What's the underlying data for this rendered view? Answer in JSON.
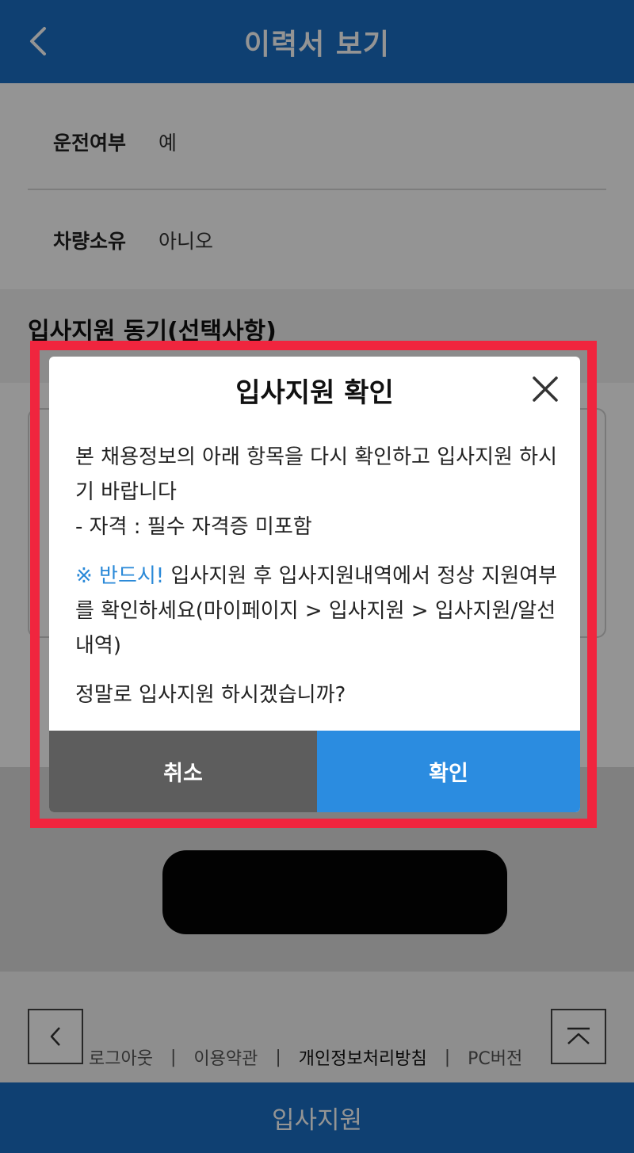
{
  "header": {
    "title": "이력서 보기",
    "back_icon": "chevron-left-icon"
  },
  "resume": {
    "rows": [
      {
        "label": "운전여부",
        "value": "예"
      },
      {
        "label": "차량소유",
        "value": "아니오"
      }
    ],
    "section_title": "입사지원 동기(선택사항)"
  },
  "footer": {
    "links": [
      "로그아웃",
      "이용약관",
      "개인정보처리방침",
      "PC버전"
    ],
    "separator": "|"
  },
  "bottom_bar": {
    "label": "입사지원"
  },
  "modal": {
    "title": "입사지원 확인",
    "close_icon": "close-icon",
    "message": "본 채용정보의 아래 항목을 다시 확인하고 입사지원 하시기 바랍니다\n- 자격 : 필수 자격증 미포함",
    "notice_prefix": "※ 반드시!",
    "notice_text": " 입사지원 후 입사지원내역에서 정상 지원여부를 확인하세요(마이페이지 > 입사지원 > 입사지원/알선 내역)",
    "question": "정말로 입사지원 하시겠습니까?",
    "cancel_label": "취소",
    "confirm_label": "확인"
  },
  "colors": {
    "brand": "#1a6fc4",
    "highlight": "#f0253e",
    "confirm": "#2b8ce0",
    "cancel": "#5d5d5d",
    "notice": "#2a89d8"
  }
}
